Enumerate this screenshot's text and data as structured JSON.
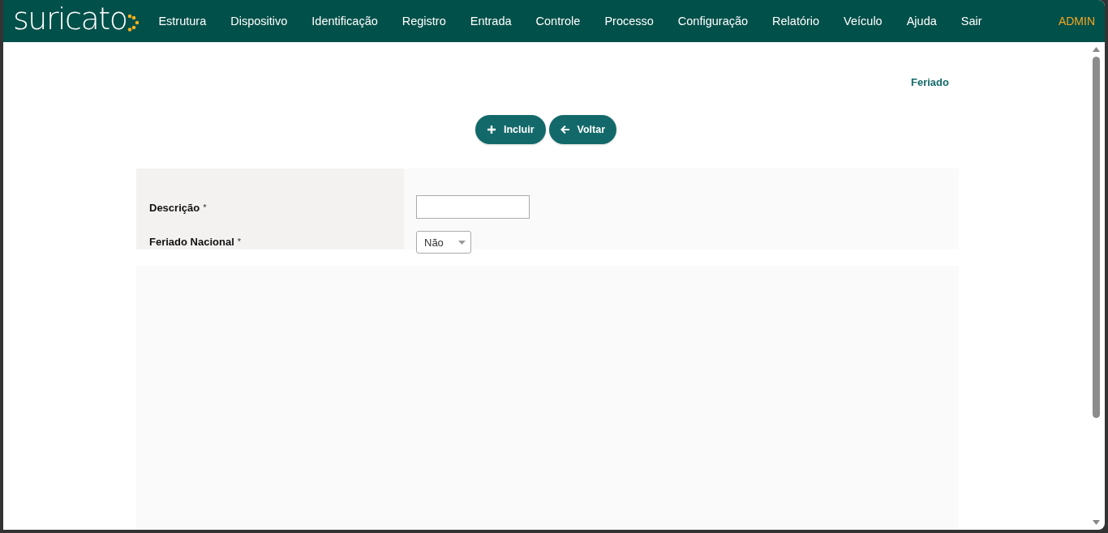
{
  "navbar": {
    "brand": "suricato",
    "menu": [
      {
        "label": "Estrutura"
      },
      {
        "label": "Dispositivo"
      },
      {
        "label": "Identificação"
      },
      {
        "label": "Registro"
      },
      {
        "label": "Entrada"
      },
      {
        "label": "Controle"
      },
      {
        "label": "Processo"
      },
      {
        "label": "Configuração"
      },
      {
        "label": "Relatório"
      },
      {
        "label": "Veículo"
      },
      {
        "label": "Ajuda"
      },
      {
        "label": "Sair"
      }
    ],
    "user": "ADMIN"
  },
  "page_title": "Feriado",
  "buttons": [
    {
      "kind": "add",
      "label": "Incluir"
    },
    {
      "kind": "back",
      "label": "Voltar"
    }
  ],
  "form": {
    "fields": [
      {
        "kind": "text",
        "label": "Descrição",
        "required_mark": "*"
      },
      {
        "kind": "select",
        "label": "Feriado Nacional",
        "required_mark": "*",
        "value": "Não"
      }
    ]
  }
}
